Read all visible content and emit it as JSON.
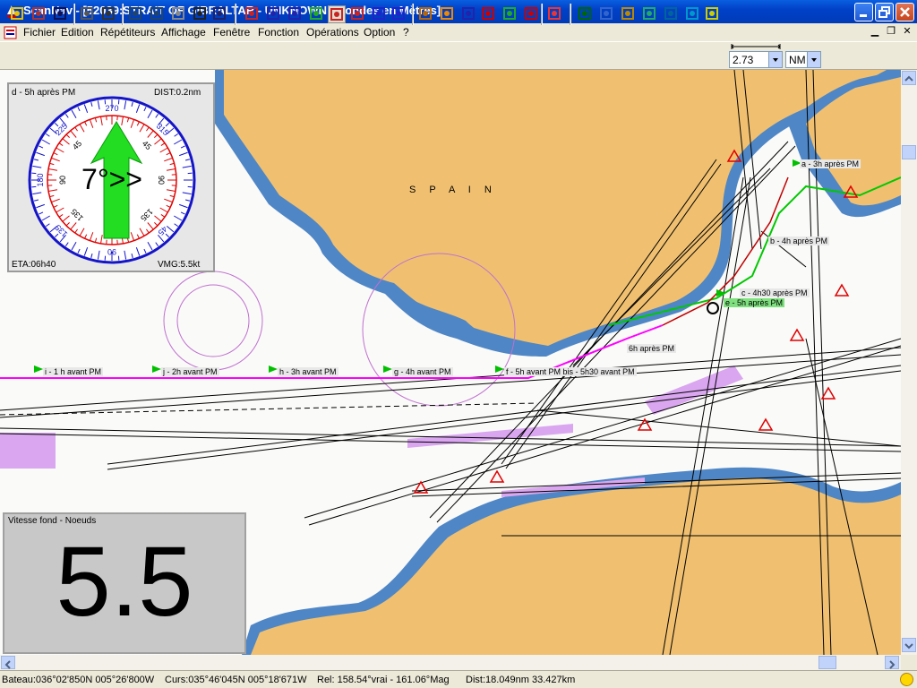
{
  "window": {
    "title": "ScanNav - [52039:STRAIT OF GIBRALTAR - UNKNOWN - Sondes en Mètres]"
  },
  "menubar": {
    "items": [
      "Fichier",
      "Edition",
      "Répétiteurs",
      "Affichage",
      "Fenêtre",
      "Fonction",
      "Opérations",
      "Option",
      "?"
    ]
  },
  "toolbar": {
    "scale_value": "2.73",
    "unit_value": "NM",
    "icons": [
      "open-chart-icon",
      "print-preview-icon",
      "save-icon",
      "print-icon",
      "help-pointer-icon",
      "zoom-in-icon",
      "zoom-out-icon",
      "pan-hand-icon",
      "select-rect-icon",
      "zoom-rect-icon",
      "boat-icon",
      "center-cross-icon",
      "route-icon",
      "waypoint-icon",
      "track-icon",
      "tide-icon",
      "text-icon",
      "overlay-icon",
      "instruments-icon",
      "nmea-icon",
      "north-up-icon",
      "heading-up-icon",
      "auto-pilot-icon",
      "mob-icon",
      "lifebuoy-icon",
      "info-icon",
      "layers-icon",
      "grid-icon",
      "crosshair-icon",
      "weather-icon",
      "arrow-icon",
      "help-icon"
    ]
  },
  "chart": {
    "land_label": "S P A I N",
    "waypoints_current": [
      "a - 3h après PM",
      "b - 4h après PM",
      "c - 4h30 après PM",
      "e - 5h après PM",
      "6h après PM"
    ],
    "waypoints_route": [
      "i - 1 h avant PM",
      "j - 2h avant PM",
      "h - 3h avant PM",
      "g - 4h avant PM",
      "f - 5h avant PM bis - 5h30 avant PM"
    ]
  },
  "compass": {
    "leg_label": "d - 5h après PM",
    "dist": "DIST:0.2nm",
    "course_text": "7°>>",
    "eta": "ETA:06h40",
    "vmg": "VMG:5.5kt",
    "ring_labels": [
      "270",
      "225",
      "180",
      "135",
      "90",
      "45",
      "315"
    ],
    "inner_labels": [
      "45",
      "90",
      "135",
      "180",
      "135",
      "90",
      "45"
    ]
  },
  "speed": {
    "title": "Vitesse fond - Noeuds",
    "value": "5.5"
  },
  "status": {
    "boat": "Bateau:036°02'850N 005°26'800W",
    "cursor": "Curs:035°46'045N 005°18'671W",
    "relative": "Rel: 158.54°vrai - 161.06°Mag",
    "dist": "Dist:18.049nm  33.427km"
  },
  "colors": {
    "land": "#f0c070",
    "shallow": "#4f86c6",
    "sea": "#fafaf8",
    "route": "#ff00ff",
    "track": "#00c800",
    "waypoint_flag": "#00c000"
  }
}
